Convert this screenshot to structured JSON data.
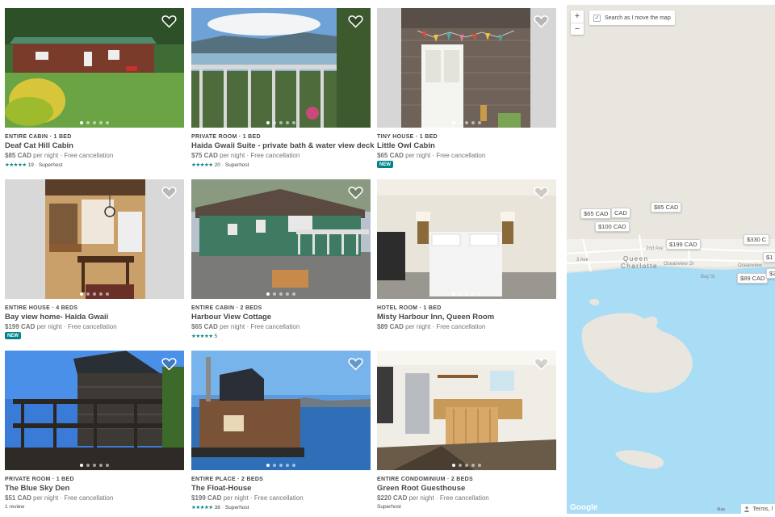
{
  "listings": [
    {
      "type": "Entire cabin · 1 bed",
      "title": "Deaf Cat Hill Cabin",
      "price": "$85 CAD",
      "per": "per night · Free cancellation",
      "stars": "★★★★★",
      "reviews": "19",
      "host": "· Superhost",
      "badge": "",
      "review_text": ""
    },
    {
      "type": "Private room · 1 bed",
      "title": "Haida Gwaii Suite - private bath & water view deck",
      "price": "$75 CAD",
      "per": "per night · Free cancellation",
      "stars": "★★★★★",
      "reviews": "20",
      "host": "· Superhost",
      "badge": "",
      "review_text": ""
    },
    {
      "type": "Tiny house · 1 bed",
      "title": "Little Owl Cabin",
      "price": "$65 CAD",
      "per": "per night · Free cancellation",
      "stars": "",
      "reviews": "",
      "host": "",
      "badge": "NEW",
      "review_text": ""
    },
    {
      "type": "Entire house · 4 beds",
      "title": "Bay view home- Haida Gwaii",
      "price": "$199 CAD",
      "per": "per night · Free cancellation",
      "stars": "",
      "reviews": "",
      "host": "",
      "badge": "NEW",
      "review_text": ""
    },
    {
      "type": "Entire cabin · 2 beds",
      "title": "Harbour View Cottage",
      "price": "$65 CAD",
      "per": "per night · Free cancellation",
      "stars": "★★★★★",
      "reviews": "5",
      "host": "",
      "badge": "",
      "review_text": ""
    },
    {
      "type": "Hotel room · 1 bed",
      "title": "Misty Harbour Inn, Queen Room",
      "price": "$89 CAD",
      "per": "per night · Free cancellation",
      "stars": "",
      "reviews": "",
      "host": "",
      "badge": "",
      "review_text": ""
    },
    {
      "type": "Private room · 1 bed",
      "title": "The Blue Sky Den",
      "price": "$51 CAD",
      "per": "per night · Free cancellation",
      "stars": "",
      "reviews": "",
      "host": "",
      "badge": "",
      "review_text": "1 review"
    },
    {
      "type": "Entire place · 2 beds",
      "title": "The Float-House",
      "price": "$199 CAD",
      "per": "per night · Free cancellation",
      "stars": "★★★★★",
      "reviews": "38",
      "host": "· Superhost",
      "badge": "",
      "review_text": ""
    },
    {
      "type": "Entire condominium · 2 beds",
      "title": "Green Root Guesthouse",
      "price": "$220 CAD",
      "per": "per night · Free cancellation",
      "stars": "",
      "reviews": "",
      "host": "",
      "badge": "",
      "review_text": "Superhost"
    }
  ],
  "map": {
    "zoom_in": "+",
    "zoom_out": "−",
    "search_toggle": "Search as I move the map",
    "search_checked": "✓",
    "pins": [
      "$65 CAD",
      "CAD",
      "$85 CAD",
      "$100 CAD",
      "$199 CAD",
      "$330 C",
      "$1",
      "$89 CAD",
      "$2"
    ],
    "streets": [
      "3 Ave",
      "2nd Ave",
      "Oceanview Dr",
      "Bay St",
      "Oceanview",
      "Oceanview Dr"
    ],
    "town": "Queen Charlotte",
    "town_line1": "Queen",
    "town_line2": "Charlotte",
    "google": "Google",
    "map_data": "Map",
    "terms": "Terms, l"
  },
  "colors": {
    "accent": "#008489",
    "water": "#a9dcf5",
    "land": "#e8e6df"
  }
}
